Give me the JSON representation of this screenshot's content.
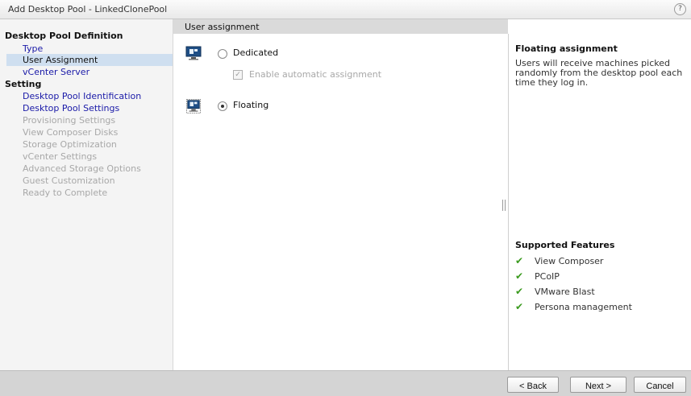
{
  "window": {
    "title": "Add Desktop Pool - LinkedClonePool",
    "help": "?"
  },
  "sidebar": {
    "sections": [
      {
        "label": "Desktop Pool Definition"
      },
      {
        "label": "Setting"
      }
    ],
    "items": [
      {
        "label": "Type",
        "state": "link"
      },
      {
        "label": "User Assignment",
        "state": "active"
      },
      {
        "label": "vCenter Server",
        "state": "link"
      },
      {
        "label": "Desktop Pool Identification",
        "state": "link"
      },
      {
        "label": "Desktop Pool Settings",
        "state": "link"
      },
      {
        "label": "Provisioning Settings",
        "state": "disabled"
      },
      {
        "label": "View Composer Disks",
        "state": "disabled"
      },
      {
        "label": "Storage Optimization",
        "state": "disabled"
      },
      {
        "label": "vCenter Settings",
        "state": "disabled"
      },
      {
        "label": "Advanced Storage Options",
        "state": "disabled"
      },
      {
        "label": "Guest Customization",
        "state": "disabled"
      },
      {
        "label": "Ready to Complete",
        "state": "disabled"
      }
    ]
  },
  "main": {
    "header": "User assignment",
    "options": {
      "dedicated": {
        "label": "Dedicated",
        "selected": false
      },
      "auto_assign": {
        "label": "Enable automatic assignment",
        "checked": true,
        "enabled": false
      },
      "floating": {
        "label": "Floating",
        "selected": true
      }
    }
  },
  "info": {
    "title": "Floating assignment",
    "text": "Users will receive machines picked randomly from the desktop pool each time they log in.",
    "features_title": "Supported Features",
    "features": [
      "View Composer",
      "PCoIP",
      "VMware Blast",
      "Persona management"
    ]
  },
  "footer": {
    "back": "< Back",
    "next": "Next >",
    "cancel": "Cancel"
  },
  "colors": {
    "link": "#1a1aa8",
    "active_bg": "#cfdff0",
    "check": "#3a9a1e"
  },
  "icons": {
    "pool": "desktop-pool-icon",
    "check": "checkmark-icon",
    "help": "help-icon"
  }
}
